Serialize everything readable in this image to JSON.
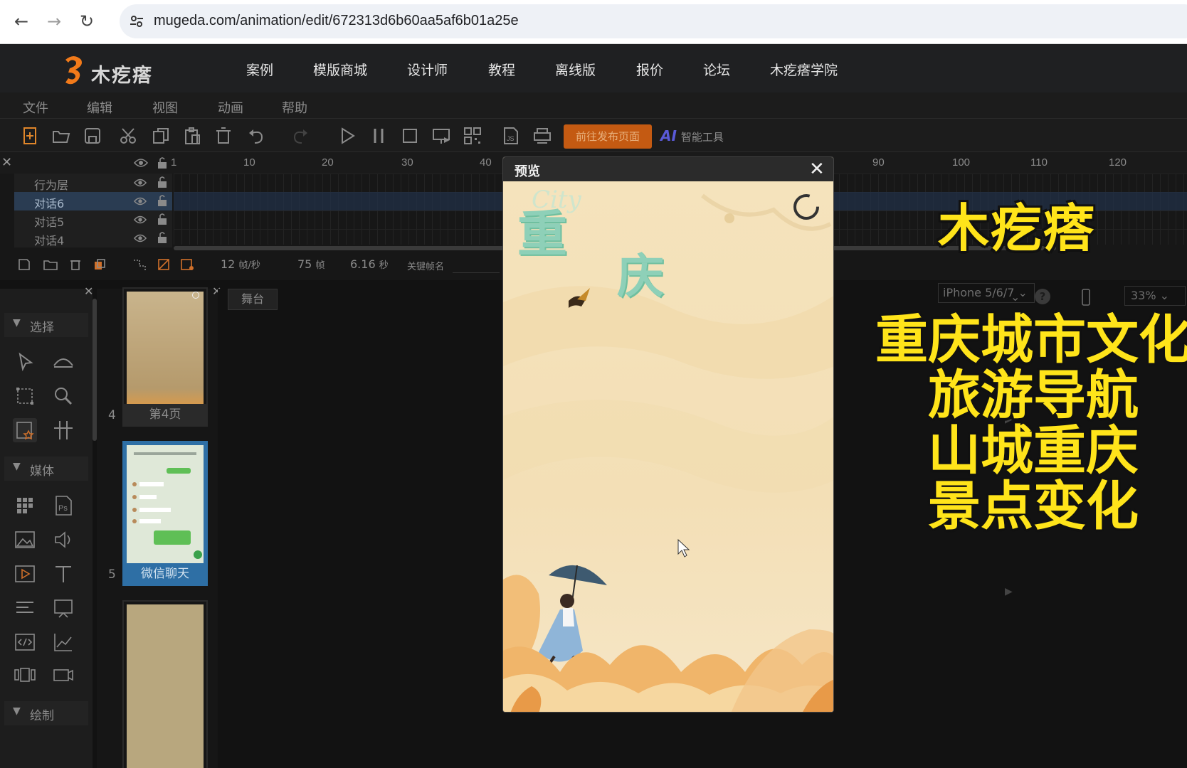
{
  "browser": {
    "url": "mugeda.com/animation/edit/672313d6b60aa5af6b01a25e"
  },
  "site": {
    "logo_text": "木疙瘩",
    "nav": [
      "案例",
      "模版商城",
      "设计师",
      "教程",
      "离线版",
      "报价",
      "论坛",
      "木疙瘩学院"
    ]
  },
  "menu": [
    "文件",
    "编辑",
    "视图",
    "动画",
    "帮助"
  ],
  "toolbar": {
    "publish_label": "前往发布页面",
    "ai_label": "智能工具",
    "ai_mark": "AI"
  },
  "timeline": {
    "ruler": [
      "1",
      "10",
      "20",
      "30",
      "40",
      "90",
      "100",
      "110",
      "120"
    ],
    "layers": [
      {
        "name": "行为层",
        "selected": false
      },
      {
        "name": "对话6",
        "selected": true
      },
      {
        "name": "对话5",
        "selected": false
      },
      {
        "name": "对话4",
        "selected": false
      }
    ],
    "fps_value": "12",
    "fps_unit": "帧/秒",
    "frames_value": "75",
    "frames_unit": "帧",
    "seconds_value": "6.16",
    "seconds_unit": "秒",
    "keyframe_label": "关键帧名"
  },
  "left_panel": {
    "sections": [
      "选择",
      "媒体",
      "绘制"
    ]
  },
  "pages": {
    "items": [
      {
        "num": "4",
        "label": "第4页",
        "selected": false
      },
      {
        "num": "5",
        "label": "微信聊天",
        "selected": true
      }
    ]
  },
  "stage": {
    "tab": "舞台",
    "device": "iPhone 5/6/7",
    "zoom": "33%"
  },
  "preview": {
    "title": "预览",
    "city_char_1": "重",
    "city_char_2": "庆",
    "city_en": "City"
  },
  "captions": {
    "title": "木疙瘩",
    "lines": [
      "重庆城市文化",
      "旅游导航",
      "山城重庆",
      "景点变化"
    ]
  },
  "colors": {
    "caption_yellow": "#ffe41a",
    "publish_orange": "#c45a12",
    "selection_blue": "#2a3c52"
  }
}
